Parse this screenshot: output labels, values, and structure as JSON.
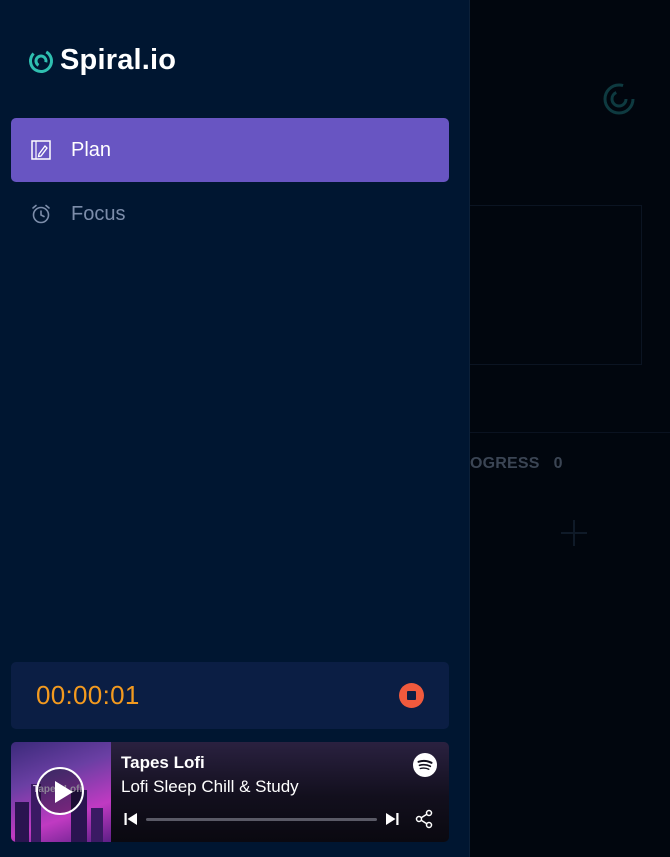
{
  "app": {
    "brand_name": "Spiral.io",
    "accent": "#6855c2",
    "background": "#001631"
  },
  "sidebar": {
    "nav": [
      {
        "label": "Plan",
        "icon": "plan-icon",
        "active": true
      },
      {
        "label": "Focus",
        "icon": "alarm-clock-icon",
        "active": false
      }
    ]
  },
  "timer": {
    "value": "00:00:01",
    "color": "#f39a1f",
    "stop_icon": "stop-icon"
  },
  "player": {
    "cover_text": "Tapes Lofi",
    "artist": "Tapes Lofi",
    "track": "Lofi Sleep Chill & Study",
    "progress": 0,
    "icons": [
      "play-icon",
      "spotify-icon",
      "previous-icon",
      "next-icon",
      "share-icon"
    ]
  },
  "background_main": {
    "progress_label": "OGRESS",
    "progress_count": "0"
  }
}
